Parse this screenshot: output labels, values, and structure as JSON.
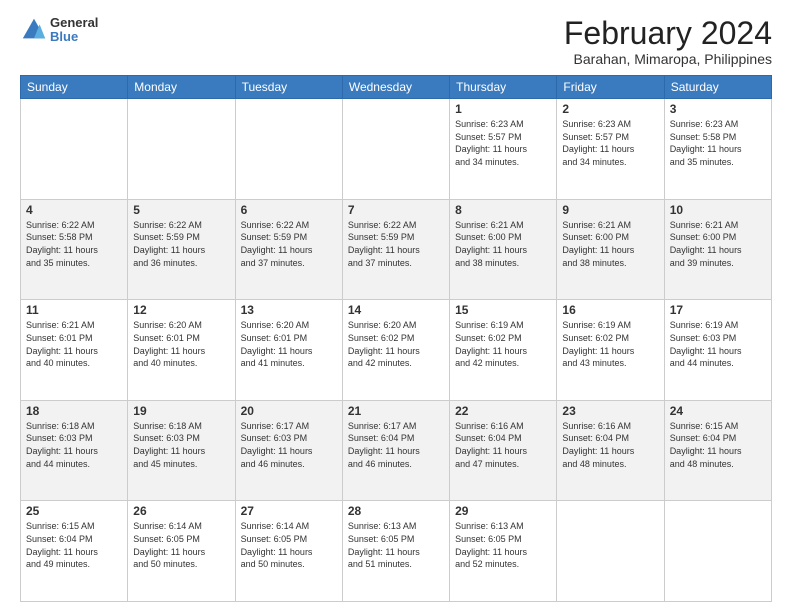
{
  "header": {
    "logo": {
      "line1": "General",
      "line2": "Blue"
    },
    "title": "February 2024",
    "subtitle": "Barahan, Mimaropa, Philippines"
  },
  "days_of_week": [
    "Sunday",
    "Monday",
    "Tuesday",
    "Wednesday",
    "Thursday",
    "Friday",
    "Saturday"
  ],
  "weeks": [
    [
      {
        "day": "",
        "info": ""
      },
      {
        "day": "",
        "info": ""
      },
      {
        "day": "",
        "info": ""
      },
      {
        "day": "",
        "info": ""
      },
      {
        "day": "1",
        "info": "Sunrise: 6:23 AM\nSunset: 5:57 PM\nDaylight: 11 hours\nand 34 minutes."
      },
      {
        "day": "2",
        "info": "Sunrise: 6:23 AM\nSunset: 5:57 PM\nDaylight: 11 hours\nand 34 minutes."
      },
      {
        "day": "3",
        "info": "Sunrise: 6:23 AM\nSunset: 5:58 PM\nDaylight: 11 hours\nand 35 minutes."
      }
    ],
    [
      {
        "day": "4",
        "info": "Sunrise: 6:22 AM\nSunset: 5:58 PM\nDaylight: 11 hours\nand 35 minutes."
      },
      {
        "day": "5",
        "info": "Sunrise: 6:22 AM\nSunset: 5:59 PM\nDaylight: 11 hours\nand 36 minutes."
      },
      {
        "day": "6",
        "info": "Sunrise: 6:22 AM\nSunset: 5:59 PM\nDaylight: 11 hours\nand 37 minutes."
      },
      {
        "day": "7",
        "info": "Sunrise: 6:22 AM\nSunset: 5:59 PM\nDaylight: 11 hours\nand 37 minutes."
      },
      {
        "day": "8",
        "info": "Sunrise: 6:21 AM\nSunset: 6:00 PM\nDaylight: 11 hours\nand 38 minutes."
      },
      {
        "day": "9",
        "info": "Sunrise: 6:21 AM\nSunset: 6:00 PM\nDaylight: 11 hours\nand 38 minutes."
      },
      {
        "day": "10",
        "info": "Sunrise: 6:21 AM\nSunset: 6:00 PM\nDaylight: 11 hours\nand 39 minutes."
      }
    ],
    [
      {
        "day": "11",
        "info": "Sunrise: 6:21 AM\nSunset: 6:01 PM\nDaylight: 11 hours\nand 40 minutes."
      },
      {
        "day": "12",
        "info": "Sunrise: 6:20 AM\nSunset: 6:01 PM\nDaylight: 11 hours\nand 40 minutes."
      },
      {
        "day": "13",
        "info": "Sunrise: 6:20 AM\nSunset: 6:01 PM\nDaylight: 11 hours\nand 41 minutes."
      },
      {
        "day": "14",
        "info": "Sunrise: 6:20 AM\nSunset: 6:02 PM\nDaylight: 11 hours\nand 42 minutes."
      },
      {
        "day": "15",
        "info": "Sunrise: 6:19 AM\nSunset: 6:02 PM\nDaylight: 11 hours\nand 42 minutes."
      },
      {
        "day": "16",
        "info": "Sunrise: 6:19 AM\nSunset: 6:02 PM\nDaylight: 11 hours\nand 43 minutes."
      },
      {
        "day": "17",
        "info": "Sunrise: 6:19 AM\nSunset: 6:03 PM\nDaylight: 11 hours\nand 44 minutes."
      }
    ],
    [
      {
        "day": "18",
        "info": "Sunrise: 6:18 AM\nSunset: 6:03 PM\nDaylight: 11 hours\nand 44 minutes."
      },
      {
        "day": "19",
        "info": "Sunrise: 6:18 AM\nSunset: 6:03 PM\nDaylight: 11 hours\nand 45 minutes."
      },
      {
        "day": "20",
        "info": "Sunrise: 6:17 AM\nSunset: 6:03 PM\nDaylight: 11 hours\nand 46 minutes."
      },
      {
        "day": "21",
        "info": "Sunrise: 6:17 AM\nSunset: 6:04 PM\nDaylight: 11 hours\nand 46 minutes."
      },
      {
        "day": "22",
        "info": "Sunrise: 6:16 AM\nSunset: 6:04 PM\nDaylight: 11 hours\nand 47 minutes."
      },
      {
        "day": "23",
        "info": "Sunrise: 6:16 AM\nSunset: 6:04 PM\nDaylight: 11 hours\nand 48 minutes."
      },
      {
        "day": "24",
        "info": "Sunrise: 6:15 AM\nSunset: 6:04 PM\nDaylight: 11 hours\nand 48 minutes."
      }
    ],
    [
      {
        "day": "25",
        "info": "Sunrise: 6:15 AM\nSunset: 6:04 PM\nDaylight: 11 hours\nand 49 minutes."
      },
      {
        "day": "26",
        "info": "Sunrise: 6:14 AM\nSunset: 6:05 PM\nDaylight: 11 hours\nand 50 minutes."
      },
      {
        "day": "27",
        "info": "Sunrise: 6:14 AM\nSunset: 6:05 PM\nDaylight: 11 hours\nand 50 minutes."
      },
      {
        "day": "28",
        "info": "Sunrise: 6:13 AM\nSunset: 6:05 PM\nDaylight: 11 hours\nand 51 minutes."
      },
      {
        "day": "29",
        "info": "Sunrise: 6:13 AM\nSunset: 6:05 PM\nDaylight: 11 hours\nand 52 minutes."
      },
      {
        "day": "",
        "info": ""
      },
      {
        "day": "",
        "info": ""
      }
    ]
  ]
}
